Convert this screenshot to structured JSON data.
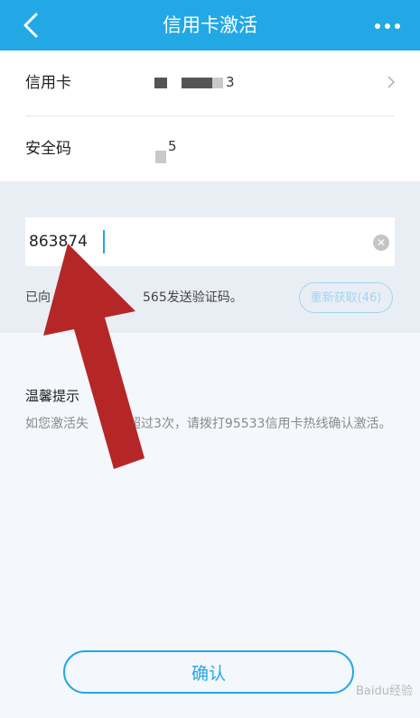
{
  "header": {
    "back_icon": "chevron-left-icon",
    "title": "信用卡激活",
    "more_icon": "more-horizontal-icon"
  },
  "form": {
    "card_label": "信用卡",
    "card_number_visible": "3",
    "security_label": "安全码",
    "security_value_visible": "5",
    "code_value": "863874",
    "sent_prefix": "已向",
    "sent_suffix": "565发送验证码。",
    "resend_label": "重新获取(46)"
  },
  "tips": {
    "title": "温馨提示",
    "body_prefix": "如您激活失",
    "body_middle": "超过3次，请拨打95533信用卡热线确认激活。"
  },
  "actions": {
    "confirm_label": "确认"
  },
  "watermark": "Baidu经验",
  "colors": {
    "primary": "#23a8e6",
    "annotation_arrow": "#b52727"
  }
}
